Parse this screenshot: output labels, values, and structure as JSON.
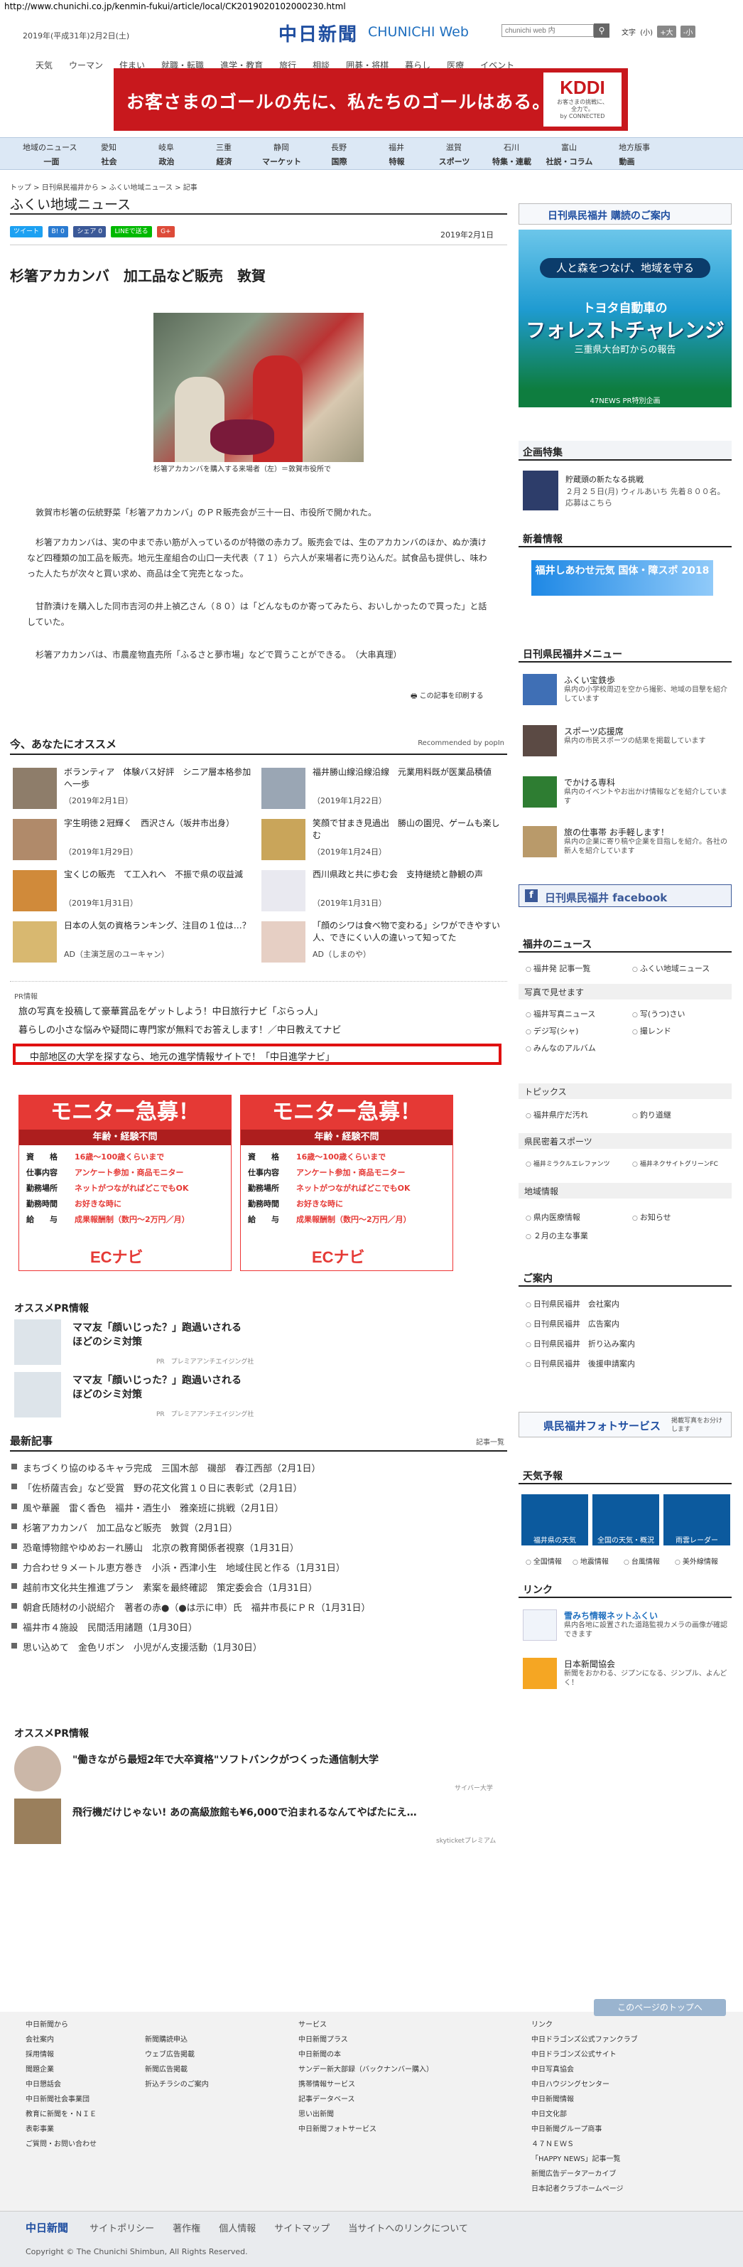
{
  "url": "http://www.chunichi.co.jp/kenmin-fukui/article/local/CK2019020102000230.html",
  "header": {
    "date": "2019年(平成31年)2月2日(土)",
    "logo": "中日新聞",
    "logo_en": "CHUNICHI Web",
    "search_placeholder": "chunichi web 内",
    "moji_label": "文字",
    "moji_mid": "(小)",
    "moji_big": "+大",
    "moji_small": "-小"
  },
  "gnav": [
    "天気",
    "ウーマン",
    "住まい",
    "就職・転職",
    "進学・教育",
    "旅行",
    "相談",
    "囲碁・将棋",
    "暮らし",
    "医療",
    "イベント"
  ],
  "banner": {
    "text": "お客さまのゴールの先に、私たちのゴールはある。",
    "brand": "KDDI",
    "sub1": "お客さまの挑戦に、",
    "sub2": "全力で。",
    "sub3": "by CONNECTED"
  },
  "nav_regions": [
    "地域のニュース",
    "愛知",
    "岐阜",
    "三重",
    "静岡",
    "長野",
    "福井",
    "滋賀",
    "石川",
    "富山",
    "地方版事"
  ],
  "nav_topics": [
    "一面",
    "社会",
    "政治",
    "経済",
    "マーケット",
    "国際",
    "特報",
    "スポーツ",
    "特集・連載",
    "社説・コラム",
    "動画"
  ],
  "breadcrumb": "トップ > 日刊県民福井から > ふくい地域ニュース > 記事",
  "page_title": "ふくい地域ニュース",
  "share": {
    "tweet": "ツイート",
    "b": "B! 0",
    "fb": "シェア 0",
    "line": "LINEで送る",
    "g": "G+"
  },
  "article": {
    "date": "2019年2月1日",
    "title": "杉箸アカカンバ　加工品など販売　敦賀",
    "caption": "杉箸アカカンバを購入する来場者（左）＝敦賀市役所で",
    "p1": "　敦賀市杉箸の伝統野菜「杉箸アカカンバ」のＰＲ販売会が三十一日、市役所で開かれた。",
    "p2": "　杉箸アカカンバは、実の中まで赤い筋が入っているのが特徴の赤カブ。販売会では、生のアカカンバのほか、ぬか漬けなど四種類の加工品を販売。地元生産組合の山口一夫代表（７１）ら六人が来場者に売り込んだ。試食品も提供し、味わった人たちが次々と買い求め、商品は全て完売となった。",
    "p3": "　甘酢漬けを購入した同市吉河の井上禎乙さん（８０）は「どんなものか寄ってみたら、おいしかったので買った」と話していた。",
    "p4": "　杉箸アカカンバは、市農産物直売所「ふるさと夢市場」などで買うことができる。　（大串真理）",
    "print": "この記事を印刷する"
  },
  "reco": {
    "title": "今、あなたにオススメ",
    "powered": "Recommended by popIn",
    "items": [
      {
        "t": "ボランティア　体験バス好評　シニア層本格参加へ一歩",
        "d": "（2019年2月1日）"
      },
      {
        "t": "福井勝山線沿線沿線　元業用料既が医業品積値",
        "d": "（2019年1月22日）"
      },
      {
        "t": "字生明徳２冠輝く　西沢さん（坂井市出身）",
        "d": "（2019年1月29日）"
      },
      {
        "t": "笑顔で甘まき見過出　勝山の園児、ゲームも楽しむ",
        "d": "（2019年1月24日）"
      },
      {
        "t": "宝くじの販売　て工入れへ　不振で県の収益減",
        "d": "（2019年1月31日）"
      },
      {
        "t": "西川県政と共に歩む会　支持継続と静観の声",
        "d": "（2019年1月31日）"
      },
      {
        "t": "日本の人気の資格ランキング、注目の１位は…？",
        "d": "AD（主演芝居のユーキャン）"
      },
      {
        "t": "「顔のシワは食べ物で変わる」シワができやすい人、できにくい人の違いって知ってた",
        "d": "AD（しまのや）"
      }
    ]
  },
  "pr": {
    "label": "PR情報",
    "lines": [
      "旅の写真を投稿して豪華賞品をゲットしよう！中日旅行ナビ「ぶらっ人」",
      "暮らしの小さな悩みや疑問に専門家が無料でお答えします！／中日教えてナビ"
    ],
    "boxed": "中部地区の大学を探すなら、地元の進学情報サイトで！「中日進学ナビ」"
  },
  "monitor": {
    "head": "モニター急募！",
    "sub": "年齢・経験不問",
    "rows": [
      [
        "資　　格",
        "16歳〜100歳くらいまで"
      ],
      [
        "仕事内容",
        "アンケート参加・商品モニター"
      ],
      [
        "勤務場所",
        "ネットがつながればどこでもOK"
      ],
      [
        "勤務時間",
        "お好きな時に"
      ],
      [
        "給　　与",
        "成果報酬制（数円〜2万円／月）"
      ]
    ],
    "brand": "ECナビ"
  },
  "osusume_pr": {
    "title": "オススメPR情報",
    "items": [
      {
        "t": "ママ友「顔いじった？」跑過いされる\nほどのシミ対策",
        "s": "PR　プレミアアンチエイジング社"
      },
      {
        "t": "ママ友「顔いじった？」跑過いされる\nほどのシミ対策",
        "s": "PR　プレミアアンチエイジング社"
      }
    ]
  },
  "latest": {
    "title": "最新記事",
    "more": "記事一覧",
    "items": [
      "まちづくり協のゆるキャラ完成　三国木部　磯部　春江西部（2月1日）",
      "「佐桥薩吉会」など受賞　野の花文化賞１０日に表彰式（2月1日）",
      "風や華麗　雷く香色　福井・酒生小　雅楽班に挑戦（2月1日）",
      "杉箸アカカンバ　加工品など販売　敦賀（2月1日）",
      "恐竜博物館やゆめおーれ勝山　北京の教育関係者視察（1月31日）",
      "力合わせ９メートル恵方巻き　小浜・西津小生　地域住民と作る（1月31日）",
      "越前市文化共生推進プラン　素案を最終確認　策定委会合（1月31日）",
      "朝倉氏随材の小説紹介　著者の赤●（●は示に申）氏　福井市長にＰＲ（1月31日）",
      "福井市４施設　民間活用諸題（1月30日）",
      "思い込めて　金色リボン　小児がん支援活動（1月30日）"
    ]
  },
  "osusume_pr2": {
    "title": "オススメPR情報",
    "items": [
      {
        "t": "\"働きながら最短2年で大卒資格\"ソフトバンクがつくった通信制大学",
        "s": "サイバー大学"
      },
      {
        "t": "飛行機だけじゃない! あの高級旅館も¥6,000で泊まれるなんてやばたにえ…",
        "s": "skyticketプレミアム"
      }
    ]
  },
  "sidebar": {
    "subscribe": "日刊県民福井 購読のご案内",
    "ad": {
      "t1": "人と森をつなげ、地域を守る",
      "t2": "トヨタ自動車の",
      "t3": "フォレストチャレンジ",
      "t4": "三重県大台町からの報告",
      "t5": "47NEWS PR特別企画"
    },
    "kikaku": {
      "title": "企画特集",
      "head": "貯蔵頭の新たなる挑戦",
      "desc": "２月２５日(月) ウィルあいち 先着８００名。応募はこちら"
    },
    "shinshun": {
      "title": "新着情報",
      "banner": "福井しあわせ元気 国体・障スポ 2018"
    },
    "menu_title": "日刊県民福井メニュー",
    "menu": [
      {
        "t": "ふくい宝鉄歩",
        "d": "県内の小学校周辺を空から撮影、地域の目撃を紹介しています"
      },
      {
        "t": "スポーツ応援席",
        "d": "県内の市民スポーツの結果を掲載しています"
      },
      {
        "t": "でかける専科",
        "d": "県内のイベントやお出かけ情報などを紹介しています"
      },
      {
        "t": "旅の仕事帯 お手軽します！",
        "d": "県内の企業に寄り稿や企業を目指しを紹介。各社の新人を紹介しています"
      }
    ],
    "facebook": "日刊県民福井 facebook",
    "fnews_title": "福井のニュース",
    "fnews": [
      [
        "福井発 記事一覧",
        "ふくい地域ニュース"
      ]
    ],
    "photo_title": "写真で見せます",
    "photo": [
      [
        "福井写真ニュース",
        "写(うつ)さい"
      ],
      [
        "デジ写(シャ)",
        "撮レンド"
      ],
      [
        "みんなのアルバム",
        ""
      ]
    ],
    "topics_title": "トピックス",
    "topics": [
      [
        "福井県庁だ汚れ",
        "釣り道継"
      ]
    ],
    "sports_title": "県民密着スポーツ",
    "sports": [
      [
        "福井ミラクルエレファンツ",
        "福井ネクサイトグリーンFC"
      ]
    ],
    "chiiki_title": "地域情報",
    "chiiki": [
      [
        "県内医療情報",
        "お知らせ"
      ],
      [
        "２月の主な事業",
        ""
      ]
    ],
    "annai_title": "ご案内",
    "annai": [
      "日刊県民福井　会社案内",
      "日刊県民福井　広告案内",
      "日刊県民福井　折り込み案内",
      "日刊県民福井　後援申請案内"
    ],
    "photosvc": "県民福井フォトサービス",
    "photosvc_sub": "掲載写真をお分けします",
    "weather_title": "天気予報",
    "weather": [
      "福井県の天気",
      "全国の天気・概況",
      "雨雲レーダー"
    ],
    "weather_links": [
      "全国情報",
      "地震情報",
      "台風情報",
      "美外線情報"
    ],
    "link_title": "リンク",
    "links": [
      {
        "t": "雪みち情報ネットふくい",
        "d": "県内各地に設置された道路監視カメラの画像が確認できます"
      },
      {
        "t": "日本新聞協会",
        "d": "新聞をおかわる、ジプンになる、ジンプル、よんどく！"
      }
    ]
  },
  "totop": "このページのトップへ",
  "footer": {
    "c1": [
      "中日新聞から",
      "会社案内",
      "採用情報",
      "聞題企業",
      "中日懇話会",
      "中日新聞社会事業団",
      "教育に新聞を・ＮＩＥ",
      "表彰事業",
      "ご質問・お問い合わせ"
    ],
    "c2": [
      "",
      "新聞購読申込",
      "ウェブ広告掲載",
      "新聞広告掲載",
      "折込チラシのご案内"
    ],
    "c3": [
      "サービス",
      "中日新聞プラス",
      "中日新聞の本",
      "サンデー新大部録（バックナンバー購入）",
      "携帯情報サービス",
      "記事データベース",
      "思い出新聞",
      "中日新聞フォトサービス"
    ],
    "c4": [
      "リンク",
      "中日ドラゴンズ公式ファンクラブ",
      "中日ドラゴンズ公式サイト",
      "中日写真協会",
      "中日ハウジングセンター",
      "中日新聞情報",
      "中日文化部",
      "中日新聞グループ商事",
      "４７ＮＥＷＳ",
      "「HAPPY NEWS」記事一覧",
      "新聞広告データアーカイブ",
      "日本記者クラブホームページ"
    ],
    "bottom_logo": "中日新聞",
    "bottom": [
      "サイトポリシー",
      "著作権",
      "個人情報",
      "サイトマップ",
      "当サイトへのリンクについて"
    ],
    "copy": "Copyright © The Chunichi Shimbun, All Rights Reserved."
  }
}
